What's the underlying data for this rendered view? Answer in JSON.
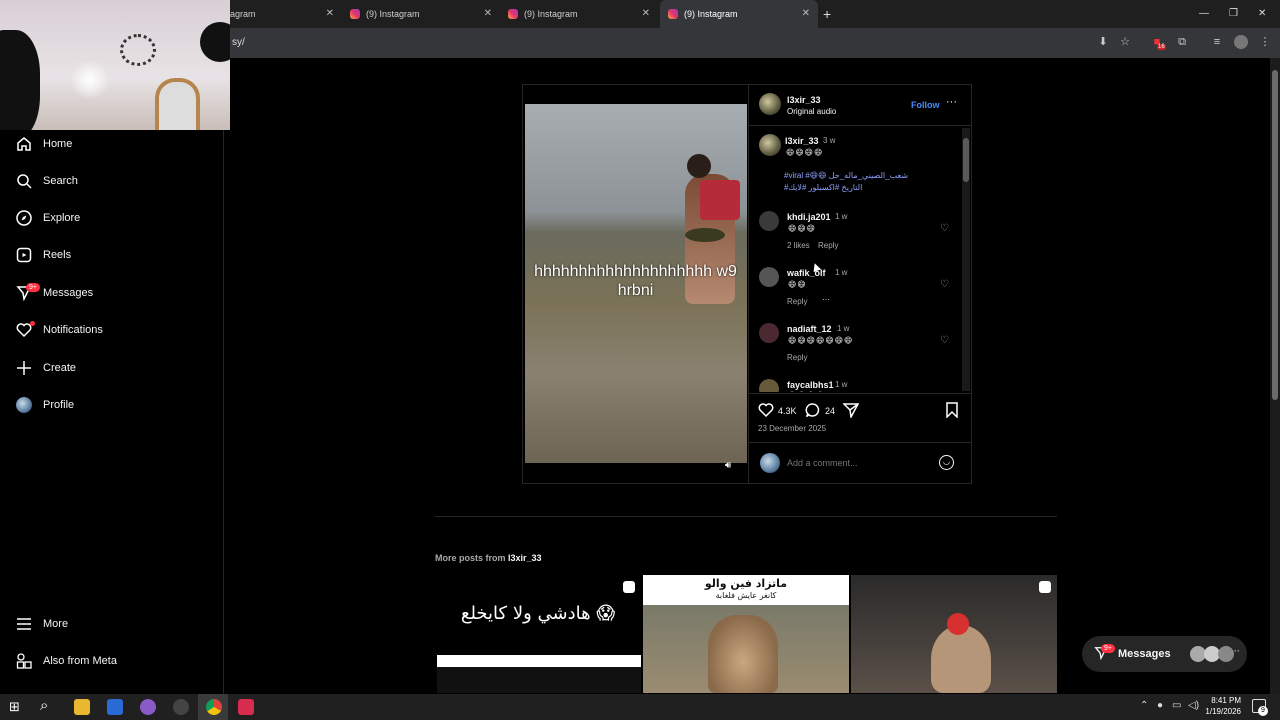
{
  "browser": {
    "tabs": [
      {
        "label": "agram"
      },
      {
        "label": "(9) Instagram"
      },
      {
        "label": "(9) Instagram"
      },
      {
        "label": "(9) Instagram"
      }
    ],
    "url": "sy/",
    "extension_badge": "16"
  },
  "sidebar": {
    "items": [
      {
        "label": "Home",
        "icon": "home-icon"
      },
      {
        "label": "Search",
        "icon": "search-icon"
      },
      {
        "label": "Explore",
        "icon": "compass-icon"
      },
      {
        "label": "Reels",
        "icon": "reels-icon"
      },
      {
        "label": "Messages",
        "icon": "messenger-icon",
        "badge": "9+"
      },
      {
        "label": "Notifications",
        "icon": "heart-icon"
      },
      {
        "label": "Create",
        "icon": "plus-icon"
      },
      {
        "label": "Profile",
        "icon": "avatar"
      }
    ],
    "more": "More",
    "also_from_meta": "Also from Meta"
  },
  "post": {
    "video_caption": "hhhhhhhhhhhhhhhhhhhh w9 hrbni",
    "author": "l3xir_33",
    "audio": "Original audio",
    "follow_label": "Follow",
    "caption": {
      "user": "l3xir_33",
      "time": "3 w",
      "emojis": "😄😄😄😄",
      "line1": "#viral #😄😄 شعب_الصيني_ماله_حل",
      "line2": "#التاريخ #اكسبلور #لايك"
    },
    "comments": [
      {
        "user": "khdi.ja201",
        "time": "1 w",
        "text": "😄😄😄",
        "likes": "2 likes",
        "reply": "Reply"
      },
      {
        "user": "wafik_olf",
        "time": "1 w",
        "text": "😄😄",
        "reply": "Reply",
        "more": "···"
      },
      {
        "user": "nadiaft_12",
        "time": "1 w",
        "text": "😄😄😄😄😄😄😄",
        "reply": "Reply"
      },
      {
        "user": "faycalbhs1",
        "time": "1 w",
        "text": "😄😄😄😄"
      }
    ],
    "likes_count": "4.3K",
    "comments_count": "24",
    "date": "23 December 2025",
    "comment_placeholder": "Add a comment..."
  },
  "more_posts": {
    "prefix": "More posts from ",
    "user": "l3xir_33",
    "thumb1_text": "هادشي ولا كايخلع 😱",
    "thumb2_title": "ماتزاد فين والو",
    "thumb2_sub": "كانغر عايش فلغابة"
  },
  "floating_messages": {
    "label": "Messages",
    "badge": "9+"
  },
  "taskbar": {
    "time": "8:41 PM",
    "date": "1/19/2026",
    "notif": "9"
  },
  "colors": {
    "accent": "#0095f6",
    "link": "#8fa2ff",
    "badge": "#ff3040"
  }
}
